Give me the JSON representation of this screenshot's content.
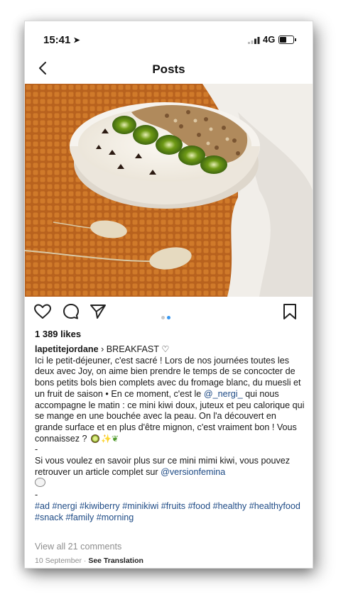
{
  "status_bar": {
    "time": "15:41",
    "network": "4G",
    "battery_level": 0.55
  },
  "nav": {
    "title": "Posts"
  },
  "post": {
    "likes": "1 389 likes",
    "username": "lapetitejordane",
    "category": "› BREAKFAST ♡",
    "caption_p1_a": "Ici le petit-déjeuner, c'est sacré ! Lors de nos journées toutes les deux avec Joy, on aime bien prendre le temps de se concocter de bons petits bols bien complets avec du fromage blanc, du muesli et un fruit de saison • En ce moment, c'est le ",
    "mention1": "@_nergi_",
    "caption_p1_b": " qui nous accompagne le matin : ce mini kiwi doux, juteux et peu calorique qui se mange en une bouchée avec la peau. On l'a découvert en grande surface et en plus d'être mignon, c'est vraiment bon ! Vous connaissez ?",
    "separator": "-",
    "caption_p2": "Si vous voulez en savoir plus sur ce mini mimi kiwi, vous pouvez retrouver un article complet sur ",
    "mention2": "@versionfemina",
    "hashtags": "#ad #nergi #kiwiberry #minikiwi #fruits #food #healthy #healthyfood #snack #family #morning",
    "comments_link": "View all 21 comments",
    "date": "10 September",
    "see_translation": "See Translation",
    "carousel": {
      "count": 2,
      "active": 1
    }
  }
}
